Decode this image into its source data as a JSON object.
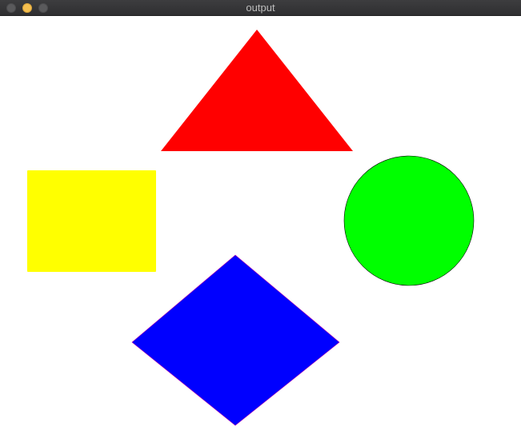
{
  "window": {
    "title": "output",
    "controls": {
      "close_color": "#5a5a5c",
      "minimize_color": "#f5bf4f",
      "zoom_color": "#5a5a5c"
    }
  },
  "canvas": {
    "background": "#ffffff",
    "shapes": [
      {
        "kind": "triangle",
        "fill": "#ff0000"
      },
      {
        "kind": "rectangle",
        "fill": "#ffff00"
      },
      {
        "kind": "circle",
        "fill": "#00ff00"
      },
      {
        "kind": "diamond",
        "fill": "#0000ff"
      }
    ]
  }
}
